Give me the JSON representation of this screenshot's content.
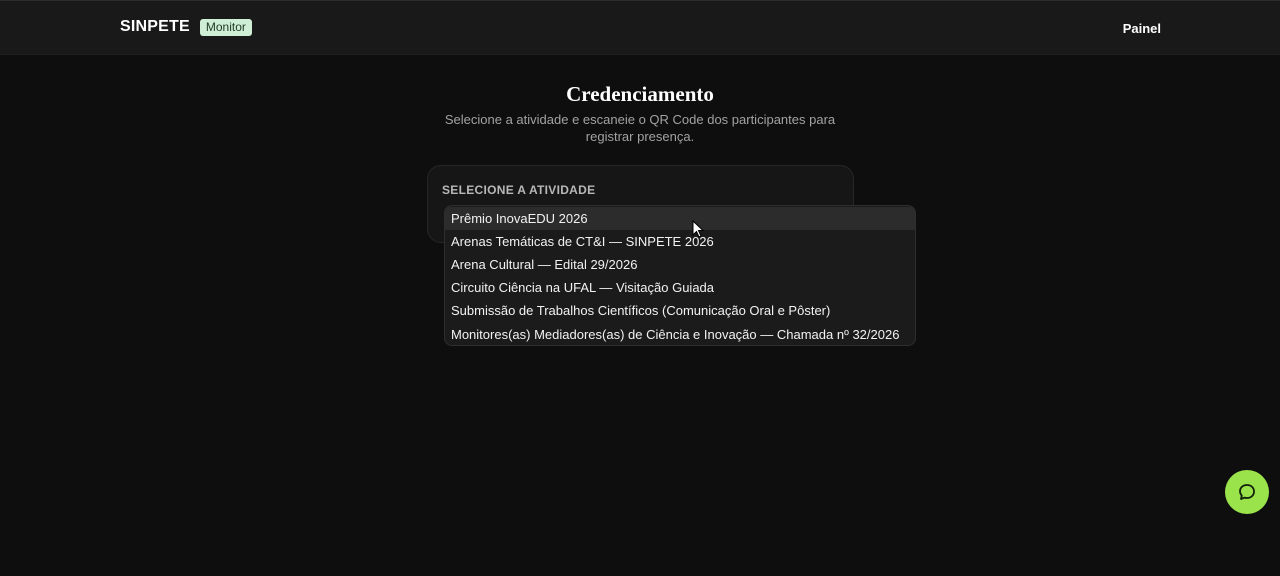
{
  "header": {
    "brand": "SINPETE",
    "badge": "Monitor",
    "nav_painel": "Painel"
  },
  "main": {
    "title": "Credenciamento",
    "subtitle": "Selecione a atividade e escaneie o QR Code dos participantes para registrar presença."
  },
  "activity_select": {
    "label": "SELECIONE A ATIVIDADE",
    "options": [
      "Prêmio InovaEDU 2026",
      "Arenas Temáticas de CT&I — SINPETE 2026",
      "Arena Cultural — Edital 29/2026",
      "Circuito Ciência na UFAL — Visitação Guiada",
      "Submissão de Trabalhos Científicos (Comunicação Oral e Pôster)",
      "Monitores(as) Mediadores(as) de Ciência e Inovação — Chamada nº 32/2026"
    ],
    "hovered_index": 0
  },
  "icons": {
    "cursor": "mouse-pointer-icon",
    "chat": "chat-bubble-icon"
  },
  "colors": {
    "background": "#0e0e0e",
    "header": "#191919",
    "badge_bg": "#cfeed6",
    "chat_fab": "#9be34a"
  }
}
